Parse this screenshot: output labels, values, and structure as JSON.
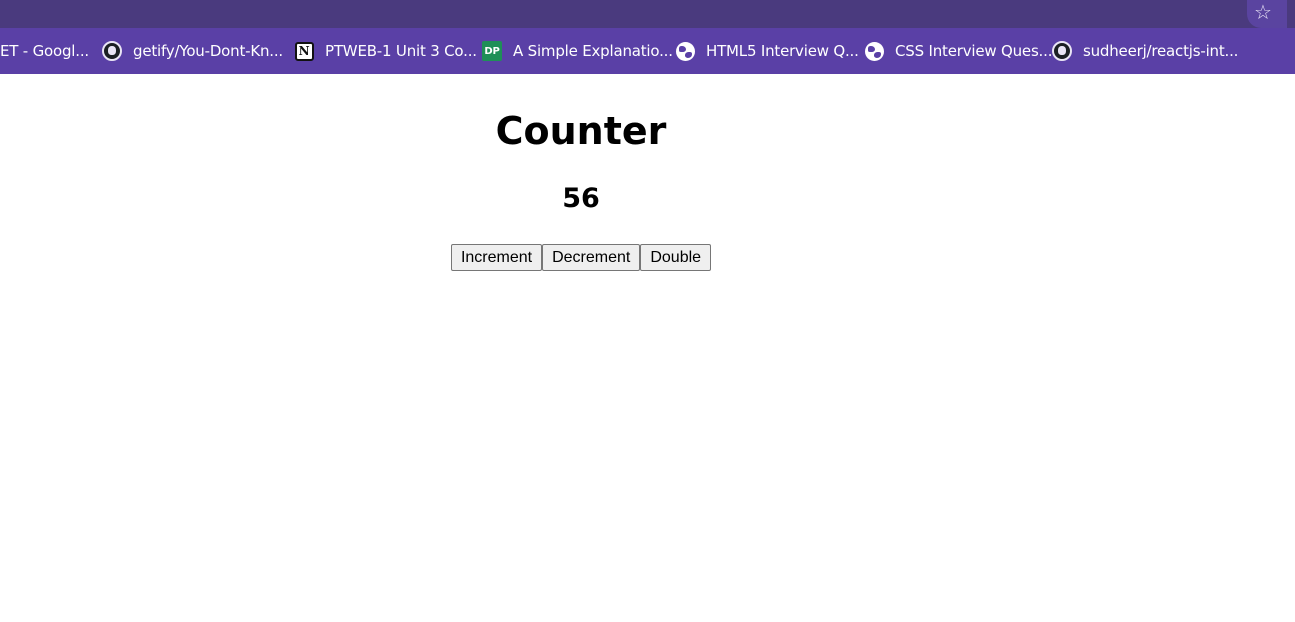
{
  "browser": {
    "bookmarks": [
      {
        "label": "ET - Googl...",
        "icon": "google-icon"
      },
      {
        "label": "getify/You-Dont-Kn...",
        "icon": "github-icon"
      },
      {
        "label": "PTWEB-1 Unit 3 Co...",
        "icon": "notion-icon"
      },
      {
        "label": "A Simple Explanatio...",
        "icon": "dp-icon",
        "icon_text": "DP"
      },
      {
        "label": "HTML5 Interview Q...",
        "icon": "globe-icon"
      },
      {
        "label": "CSS Interview Ques...",
        "icon": "globe-icon"
      },
      {
        "label": "sudheerj/reactjs-int...",
        "icon": "github-icon"
      }
    ],
    "star_icon": "star-icon",
    "notion_glyph": "N",
    "colors": {
      "top_bar": "#4a3a7e",
      "bookmarks_bar": "#5a40a6"
    }
  },
  "app": {
    "title": "Counter",
    "count": "56",
    "buttons": {
      "increment": "Increment",
      "decrement": "Decrement",
      "double": "Double"
    }
  }
}
